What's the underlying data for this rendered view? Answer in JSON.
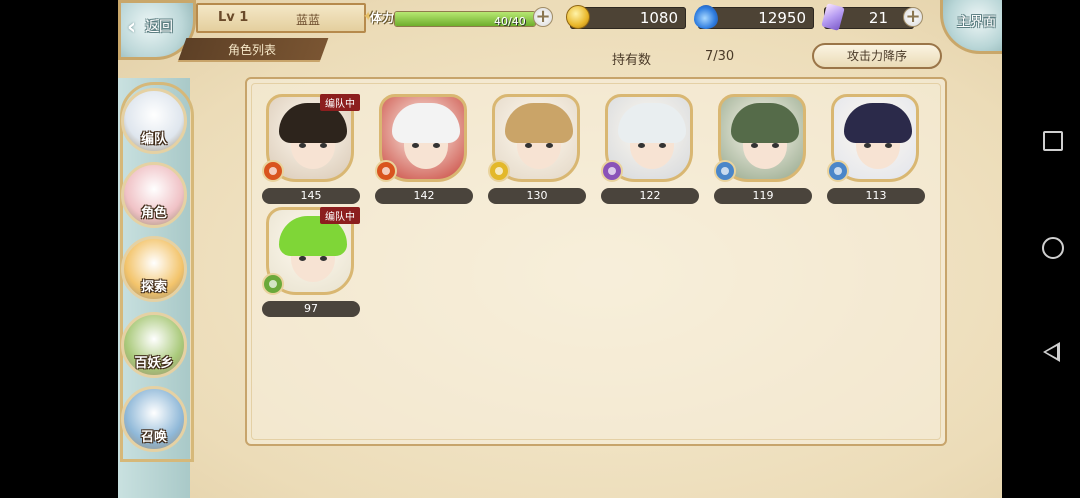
{
  "header": {
    "back_label": "返回",
    "level": "Lv 1",
    "player_name": "蓝蓝",
    "list_tab": "角色列表",
    "stamina_label": "体力",
    "stamina_value": "40/40",
    "stamina_fraction": 1.0,
    "gold": "1080",
    "spirit": "12950",
    "crystal": "21",
    "main_label": "主界面"
  },
  "toolbar": {
    "owned_label": "持有数",
    "owned_value": "7/30",
    "sort_label": "攻击力降序"
  },
  "menu": [
    {
      "label": "编队",
      "color": "#dfe6ee"
    },
    {
      "label": "角色",
      "color": "#f0c2c6"
    },
    {
      "label": "探索",
      "color": "#f3c46b"
    },
    {
      "label": "百妖乡",
      "color": "#a9c97a"
    },
    {
      "label": "召唤",
      "color": "#8fb8d8"
    }
  ],
  "characters": [
    {
      "power": "145",
      "badge": "编队中",
      "hair": "#2d241c",
      "bg": "#d9c9b6",
      "elem": "#d9541e"
    },
    {
      "power": "142",
      "badge": "",
      "hair": "#f3f3f3",
      "bg": "#c9473e",
      "elem": "#d9541e"
    },
    {
      "power": "130",
      "badge": "",
      "hair": "#caa468",
      "bg": "#e3d7c6",
      "elem": "#e3b82a"
    },
    {
      "power": "122",
      "badge": "",
      "hair": "#e9eef0",
      "bg": "#d5d8dc",
      "elem": "#8a53b8"
    },
    {
      "power": "119",
      "badge": "",
      "hair": "#556b49",
      "bg": "#95a88c",
      "elem": "#4a86c9"
    },
    {
      "power": "113",
      "badge": "",
      "hair": "#2b2a4a",
      "bg": "#e1e4ec",
      "elem": "#4a86c9"
    },
    {
      "power": "97",
      "badge": "编队中",
      "hair": "#7fd637",
      "bg": "#e8e2cf",
      "elem": "#6ba93a"
    }
  ]
}
